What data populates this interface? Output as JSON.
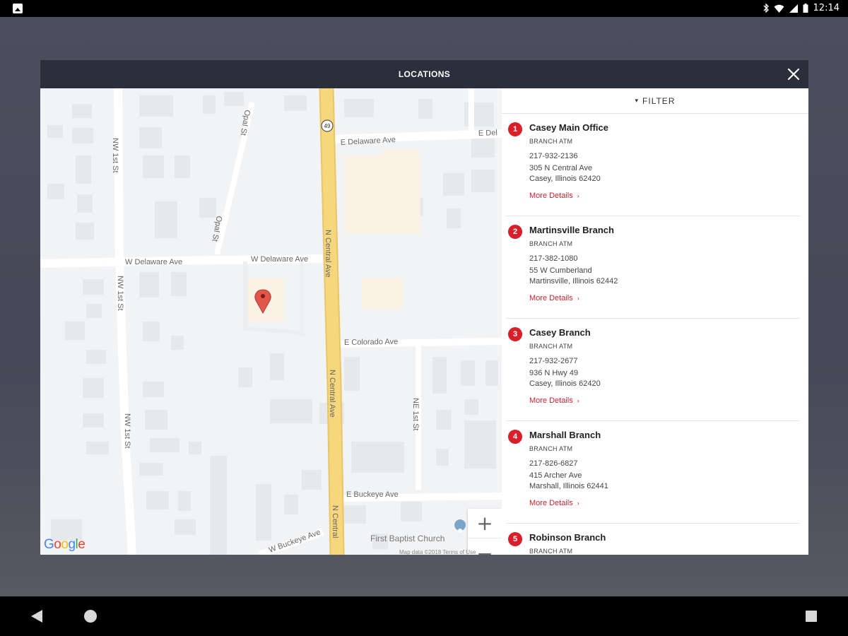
{
  "status_bar": {
    "time": "12:14"
  },
  "modal": {
    "title": "LOCATIONS"
  },
  "filter": {
    "label": "FILTER"
  },
  "locations": [
    {
      "number": "1",
      "name": "Casey Main Office",
      "types": "BRANCH ATM",
      "phone": "217-932-2136",
      "address_line1": "305 N Central Ave",
      "address_line2": "Casey, Illinois 62420",
      "more_label": "More Details"
    },
    {
      "number": "2",
      "name": "Martinsville Branch",
      "types": "BRANCH ATM",
      "phone": "217-382-1080",
      "address_line1": "55 W Cumberland",
      "address_line2": "Martinsville, Illinois 62442",
      "more_label": "More Details"
    },
    {
      "number": "3",
      "name": "Casey Branch",
      "types": "BRANCH ATM",
      "phone": "217-932-2677",
      "address_line1": "936 N Hwy 49",
      "address_line2": "Casey, Illinois 62420",
      "more_label": "More Details"
    },
    {
      "number": "4",
      "name": "Marshall Branch",
      "types": "BRANCH ATM",
      "phone": "217-826-6827",
      "address_line1": "415 Archer Ave",
      "address_line2": "Marshall, Illinois 62441",
      "more_label": "More Details"
    },
    {
      "number": "5",
      "name": "Robinson Branch",
      "types": "BRANCH ATM",
      "phone": "",
      "address_line1": "",
      "address_line2": "",
      "more_label": ""
    }
  ],
  "map": {
    "route_shield": "49",
    "street_labels": {
      "e_delaware": "E Delaware Ave",
      "e_delaware_cut": "E Del",
      "w_delaware": "W Delaware Ave",
      "w_delaware_2": "W Delaware Ave",
      "n_central_1": "N Central Ave",
      "n_central_2": "N Central Ave",
      "n_central_3": "N Central",
      "e_colorado": "E Colorado Ave",
      "e_buckeye": "E Buckeye Ave",
      "w_buckeye": "W Buckeye Ave",
      "nw_1st_a": "NW 1st St",
      "nw_1st_b": "NW 1st St",
      "nw_1st_c": "NW 1st St",
      "ne_1st": "NE 1st St",
      "opal_1": "Opal St",
      "opal_2": "Opal St"
    },
    "poi_label": "First Baptist Church",
    "attribution": "Map data ©2018    Terms of Use",
    "zoom_in": "+",
    "zoom_out": "−",
    "google_letters": [
      "G",
      "o",
      "o",
      "g",
      "l",
      "e"
    ]
  },
  "colors": {
    "accent": "#d81f2a",
    "header": "#2b2e3b",
    "highway": "#f7d77e",
    "marker": "#e2574c"
  }
}
